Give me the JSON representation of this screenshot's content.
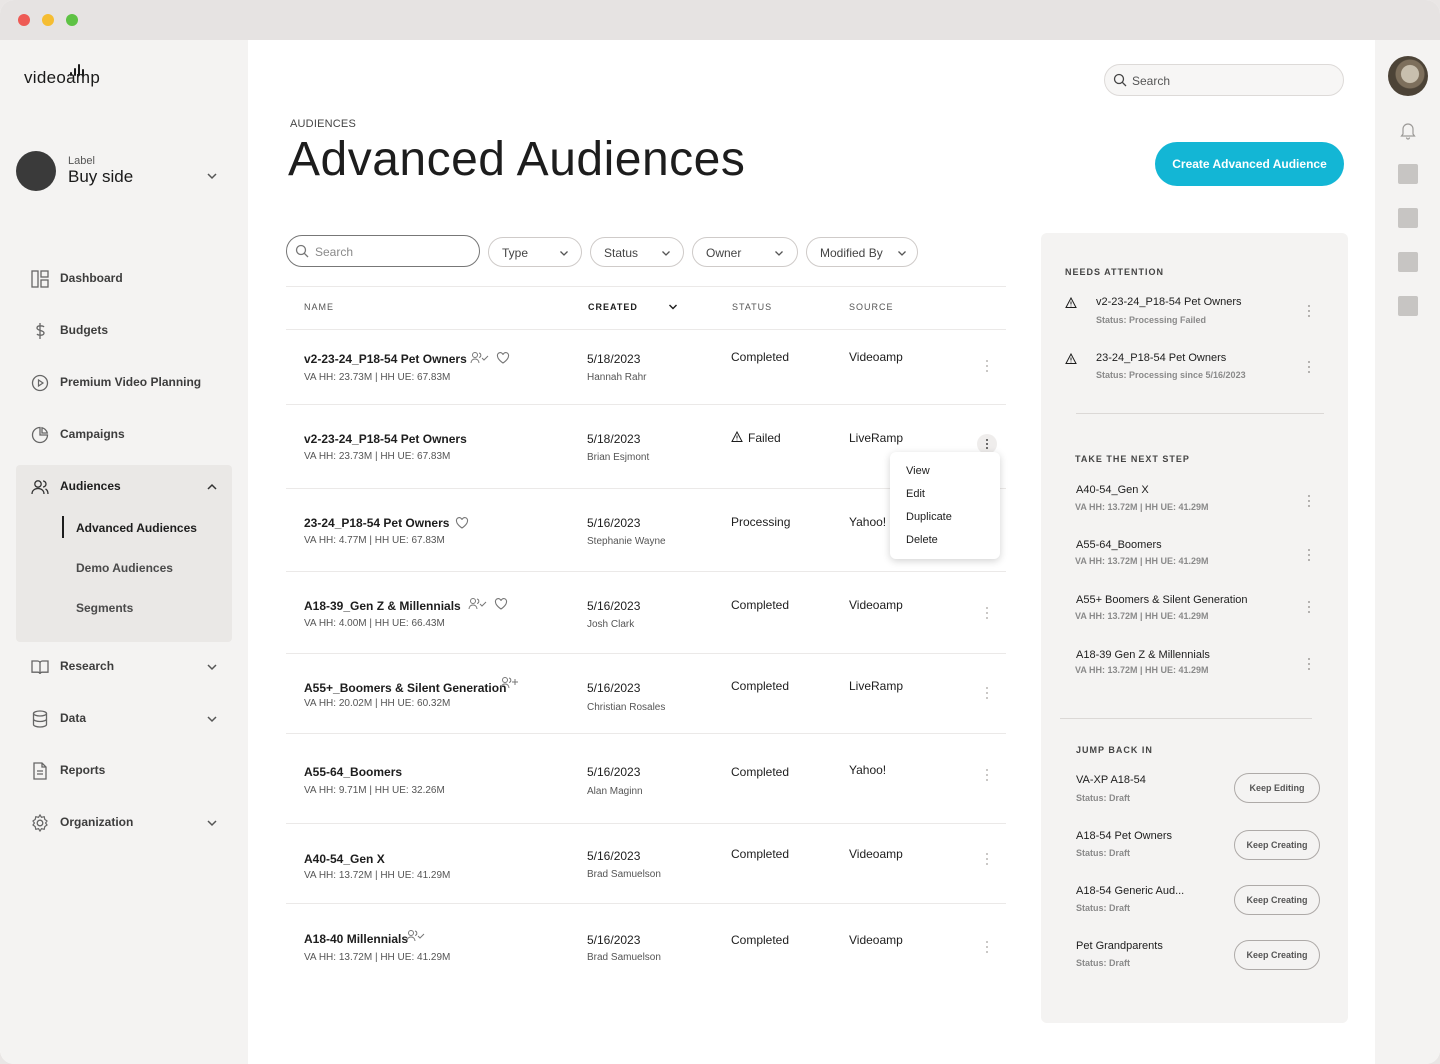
{
  "app": {
    "logo_text": "videoamp",
    "account_label": "Label",
    "account_name": "Buy side"
  },
  "nav": {
    "items": [
      {
        "label": "Dashboard",
        "icon": "dashboard-icon"
      },
      {
        "label": "Budgets",
        "icon": "dollar-icon"
      },
      {
        "label": "Premium Video Planning",
        "icon": "play-circle-icon"
      },
      {
        "label": "Campaigns",
        "icon": "pie-chart-icon"
      },
      {
        "label": "Audiences",
        "icon": "users-icon",
        "expanded": true
      },
      {
        "label": "Research",
        "icon": "book-icon"
      },
      {
        "label": "Data",
        "icon": "database-icon"
      },
      {
        "label": "Reports",
        "icon": "document-icon"
      },
      {
        "label": "Organization",
        "icon": "gear-icon"
      }
    ],
    "audience_sub": [
      "Advanced Audiences",
      "Demo Audiences",
      "Segments"
    ],
    "active_sub": "Advanced Audiences"
  },
  "header": {
    "search_placeholder": "Search",
    "breadcrumb": "AUDIENCES",
    "title": "Advanced Audiences",
    "create_button": "Create Advanced Audience"
  },
  "filters": {
    "search_placeholder": "Search",
    "dropdowns": [
      "Type",
      "Status",
      "Owner",
      "Modified By"
    ]
  },
  "table": {
    "columns": [
      "NAME",
      "CREATED",
      "STATUS",
      "SOURCE"
    ],
    "rows": [
      {
        "name": "v2-23-24_P18-54 Pet Owners",
        "meta": "VA HH: 23.73M | HH UE: 67.83M",
        "date": "5/18/2023",
        "owner": "Hannah Rahr",
        "status": "Completed",
        "source": "Videoamp"
      },
      {
        "name": "v2-23-24_P18-54 Pet Owners",
        "meta": "VA HH: 23.73M |  HH UE: 67.83M",
        "date": "5/18/2023",
        "owner": "Brian Esjmont",
        "status": "Failed",
        "source": "LiveRamp"
      },
      {
        "name": "23-24_P18-54 Pet Owners",
        "meta": "VA HH: 4.77M | HH UE: 67.83M",
        "date": "5/16/2023",
        "owner": "Stephanie Wayne",
        "status": "Processing",
        "source": "Yahoo!"
      },
      {
        "name": "A18-39_Gen Z & Millennials",
        "meta": "VA HH: 4.00M | HH UE: 66.43M",
        "date": "5/16/2023",
        "owner": "Josh Clark",
        "status": "Completed",
        "source": "Videoamp"
      },
      {
        "name": "A55+_Boomers & Silent Generation",
        "meta": "VA HH: 20.02M | HH UE: 60.32M",
        "date": "5/16/2023",
        "owner": "Christian Rosales",
        "status": "Completed",
        "source": "LiveRamp"
      },
      {
        "name": "A55-64_Boomers",
        "meta": "VA HH: 9.71M | HH UE: 32.26M",
        "date": "5/16/2023",
        "owner": "Alan Maginn",
        "status": "Completed",
        "source": "Yahoo!"
      },
      {
        "name": "A40-54_Gen X",
        "meta": "VA HH: 13.72M | HH UE: 41.29M",
        "date": "5/16/2023",
        "owner": "Brad Samuelson",
        "status": "Completed",
        "source": "Videoamp"
      },
      {
        "name": "A18-40 Millennials",
        "meta": "VA HH: 13.72M | HH UE: 41.29M",
        "date": "5/16/2023",
        "owner": "Brad Samuelson",
        "status": "Completed",
        "source": "Videoamp"
      }
    ]
  },
  "context_menu": {
    "items": [
      "View",
      "Edit",
      "Duplicate",
      "Delete"
    ]
  },
  "panel": {
    "needs_attention": {
      "heading": "NEEDS ATTENTION",
      "items": [
        {
          "title": "v2-23-24_P18-54 Pet Owners",
          "sub": "Status: Processing Failed"
        },
        {
          "title": "23-24_P18-54 Pet Owners",
          "sub": "Status: Processing since 5/16/2023"
        }
      ]
    },
    "next_step": {
      "heading": "TAKE THE NEXT STEP",
      "items": [
        {
          "title": "A40-54_Gen X",
          "sub": "VA HH: 13.72M | HH UE: 41.29M"
        },
        {
          "title": "A55-64_Boomers",
          "sub": "VA HH: 13.72M | HH UE: 41.29M"
        },
        {
          "title": "A55+  Boomers & Silent Generation",
          "sub": "VA HH: 13.72M | HH UE: 41.29M"
        },
        {
          "title": "A18-39  Gen Z & Millennials",
          "sub": "VA HH: 13.72M | HH UE: 41.29M"
        }
      ]
    },
    "jump_back": {
      "heading": "JUMP BACK IN",
      "items": [
        {
          "title": "VA-XP A18-54",
          "sub": "Status: Draft",
          "button": "Keep Editing"
        },
        {
          "title": "A18-54 Pet Owners",
          "sub": "Status: Draft",
          "button": "Keep Creating"
        },
        {
          "title": "A18-54 Generic Aud...",
          "sub": "Status: Draft",
          "button": "Keep Creating"
        },
        {
          "title": "Pet Grandparents",
          "sub": "Status: Draft",
          "button": "Keep Creating"
        }
      ]
    }
  },
  "colors": {
    "accent": "#13b6d5",
    "sidebar_bg": "#f4f3f2",
    "text": "#1d1d1d"
  }
}
